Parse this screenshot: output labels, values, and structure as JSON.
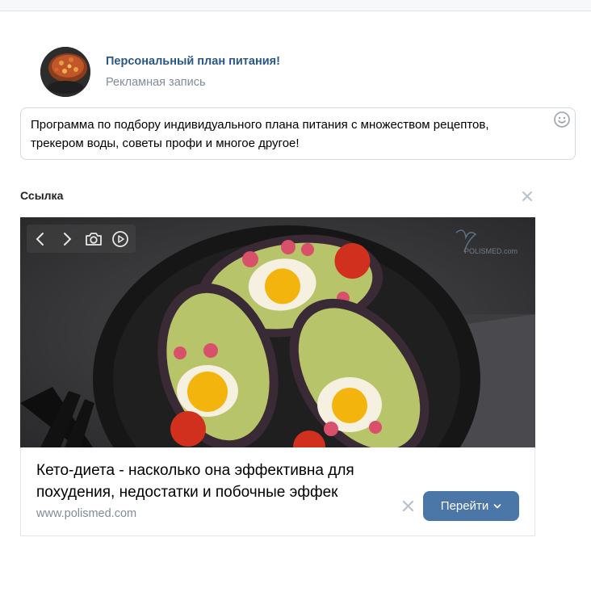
{
  "post": {
    "title": "Персональный план питания!",
    "subtitle": "Рекламная запись",
    "text": "Программа по подбору индивидуального плана питания с множеством рецептов, трекером воды, советы профи и многое другое!"
  },
  "attachment": {
    "section_label": "Ссылка",
    "card_title": "Кето-диета - насколько она эффективна для похудения, недостатки и побочные эффек",
    "card_url": "www.polismed.com",
    "go_button": "Перейти",
    "photo_watermark": "POLISMED.com"
  },
  "icons": {
    "emoji": "smile-icon",
    "close": "close-icon",
    "prev": "chevron-left-icon",
    "next": "chevron-right-icon",
    "camera": "camera-icon",
    "play": "play-icon",
    "dropdown": "chevron-down-icon"
  },
  "colors": {
    "accent": "#4a76a8",
    "title_link": "#2a5885",
    "muted": "#818c99"
  }
}
